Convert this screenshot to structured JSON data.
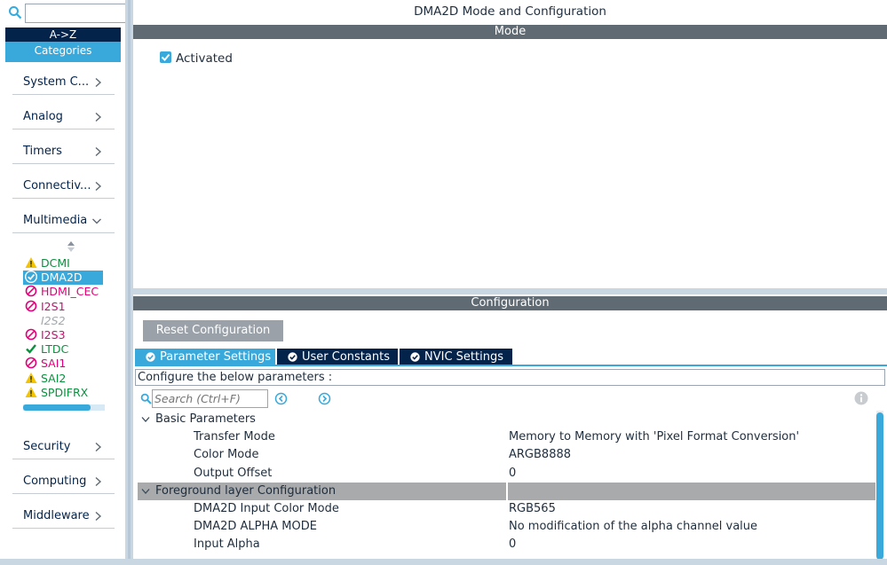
{
  "sidebar": {
    "search": {
      "value": "",
      "placeholder": ""
    },
    "sort_label": "A->Z",
    "categories_label": "Categories",
    "categories_top": [
      {
        "label": "System C...",
        "expanded": false
      },
      {
        "label": "Analog",
        "expanded": false
      },
      {
        "label": "Timers",
        "expanded": false
      },
      {
        "label": "Connectiv...",
        "expanded": false
      },
      {
        "label": "Multimedia",
        "expanded": true
      }
    ],
    "peripherals": [
      {
        "label": "DCMI",
        "status": "warning"
      },
      {
        "label": "DMA2D",
        "status": "ok",
        "selected": true
      },
      {
        "label": "HDMI_CEC",
        "status": "blocked"
      },
      {
        "label": "I2S1",
        "status": "blocked"
      },
      {
        "label": "I2S2",
        "status": "disabled"
      },
      {
        "label": "I2S3",
        "status": "blocked"
      },
      {
        "label": "LTDC",
        "status": "ok"
      },
      {
        "label": "SAI1",
        "status": "blocked"
      },
      {
        "label": "SAI2",
        "status": "warning"
      },
      {
        "label": "SPDIFRX",
        "status": "warning"
      }
    ],
    "categories_bottom": [
      {
        "label": "Security",
        "expanded": false
      },
      {
        "label": "Computing",
        "expanded": false
      },
      {
        "label": "Middleware",
        "expanded": false
      }
    ]
  },
  "main": {
    "title": "DMA2D Mode and Configuration",
    "mode_header": "Mode",
    "activated": {
      "label": "Activated",
      "checked": true
    },
    "config_header": "Configuration",
    "reset_label": "Reset Configuration",
    "tabs": [
      {
        "label": "Parameter Settings",
        "active": true
      },
      {
        "label": "User Constants",
        "active": false
      },
      {
        "label": "NVIC Settings",
        "active": false
      }
    ],
    "hint": "Configure the below parameters :",
    "param_search": {
      "value": "",
      "placeholder": "Search (Ctrl+F)"
    },
    "groups": [
      {
        "label": "Basic Parameters",
        "highlighted": false,
        "params": [
          {
            "name": "Transfer Mode",
            "value": "Memory to Memory with 'Pixel Format Conversion'"
          },
          {
            "name": "Color Mode",
            "value": "ARGB8888"
          },
          {
            "name": "Output Offset",
            "value": "0"
          }
        ]
      },
      {
        "label": "Foreground layer Configuration",
        "highlighted": true,
        "params": [
          {
            "name": "DMA2D Input Color Mode",
            "value": "RGB565"
          },
          {
            "name": "DMA2D ALPHA MODE",
            "value": "No modification of the alpha channel value"
          },
          {
            "name": "Input Alpha",
            "value": "0"
          }
        ]
      }
    ]
  },
  "colors": {
    "accent": "#39a9dc",
    "navy": "#03234b",
    "header_gray": "#5f6a73",
    "ok_green": "#0c8f3e",
    "blocked_pink": "#e2007a",
    "warning_yellow": "#f5c400"
  },
  "icons": {
    "search": "search-icon",
    "chevron_right": "chevron-right-icon",
    "chevron_down": "chevron-down-icon",
    "info": "info-icon",
    "check": "check-icon",
    "warning": "warning-icon",
    "blocked": "blocked-icon",
    "nav_prev": "previous-match-icon",
    "nav_next": "next-match-icon"
  }
}
